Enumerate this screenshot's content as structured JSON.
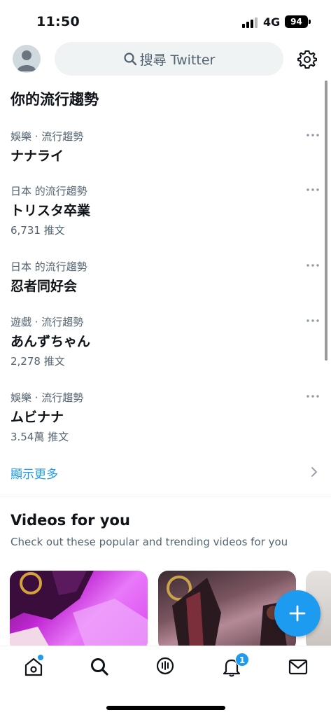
{
  "status_bar": {
    "time": "11:50",
    "network": "4G",
    "battery": "94"
  },
  "header": {
    "search_placeholder": "搜尋 Twitter"
  },
  "trends_section": {
    "title": "你的流行趨勢",
    "items": [
      {
        "category": "娛樂 · 流行趨勢",
        "name": "ナナライ",
        "count": ""
      },
      {
        "category": "日本 的流行趨勢",
        "name": "トリスタ卒業",
        "count": "6,731 推文"
      },
      {
        "category": "日本 的流行趨勢",
        "name": "忍者同好会",
        "count": ""
      },
      {
        "category": "遊戲 · 流行趨勢",
        "name": "あんずちゃん",
        "count": "2,278 推文"
      },
      {
        "category": "娛樂 · 流行趨勢",
        "name": "ムビナナ",
        "count": "3.54萬 推文"
      }
    ],
    "show_more": "顯示更多"
  },
  "videos_section": {
    "title": "Videos for you",
    "subtitle": "Check out these popular and trending videos for you"
  },
  "tabbar": {
    "notifications_badge": "1"
  },
  "colors": {
    "accent": "#1d9bf0",
    "secondary_text": "#536471",
    "search_bg": "#eff3f4"
  },
  "icons": [
    "search-icon",
    "gear-icon",
    "more-icon",
    "chevron-right-icon",
    "plus-icon",
    "home-icon",
    "search-tab-icon",
    "spaces-icon",
    "bell-icon",
    "mail-icon"
  ]
}
